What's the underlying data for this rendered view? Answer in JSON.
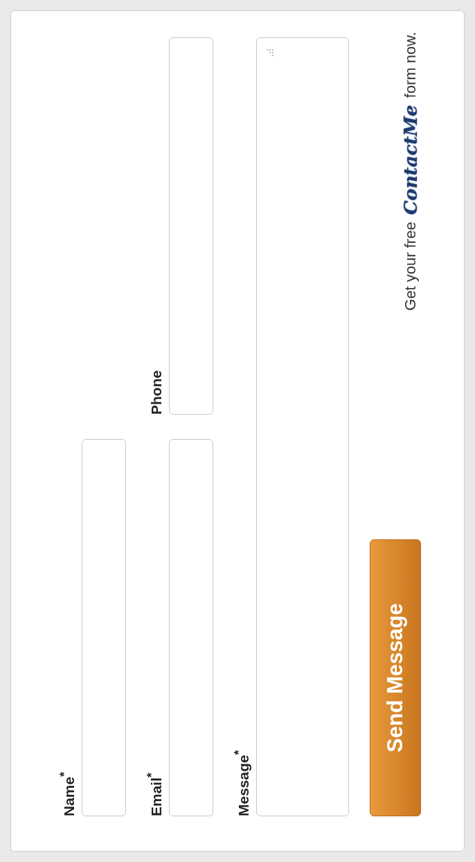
{
  "fields": [
    {
      "label": "Name$^{*}$",
      "kind": "input"
    },
    {
      "label": "Email$^{*}$",
      "kind": "input"
    },
    {
      "label": "Phone",
      "kind": "input"
    },
    {
      "label": "Message$^{*}$",
      "kind": "textarea"
    }
  ],
  "button": "Send Message",
  "footer": {
    "before": "Get your free",
    "logo": "ContactMe",
    "after": "form now."
  }
}
